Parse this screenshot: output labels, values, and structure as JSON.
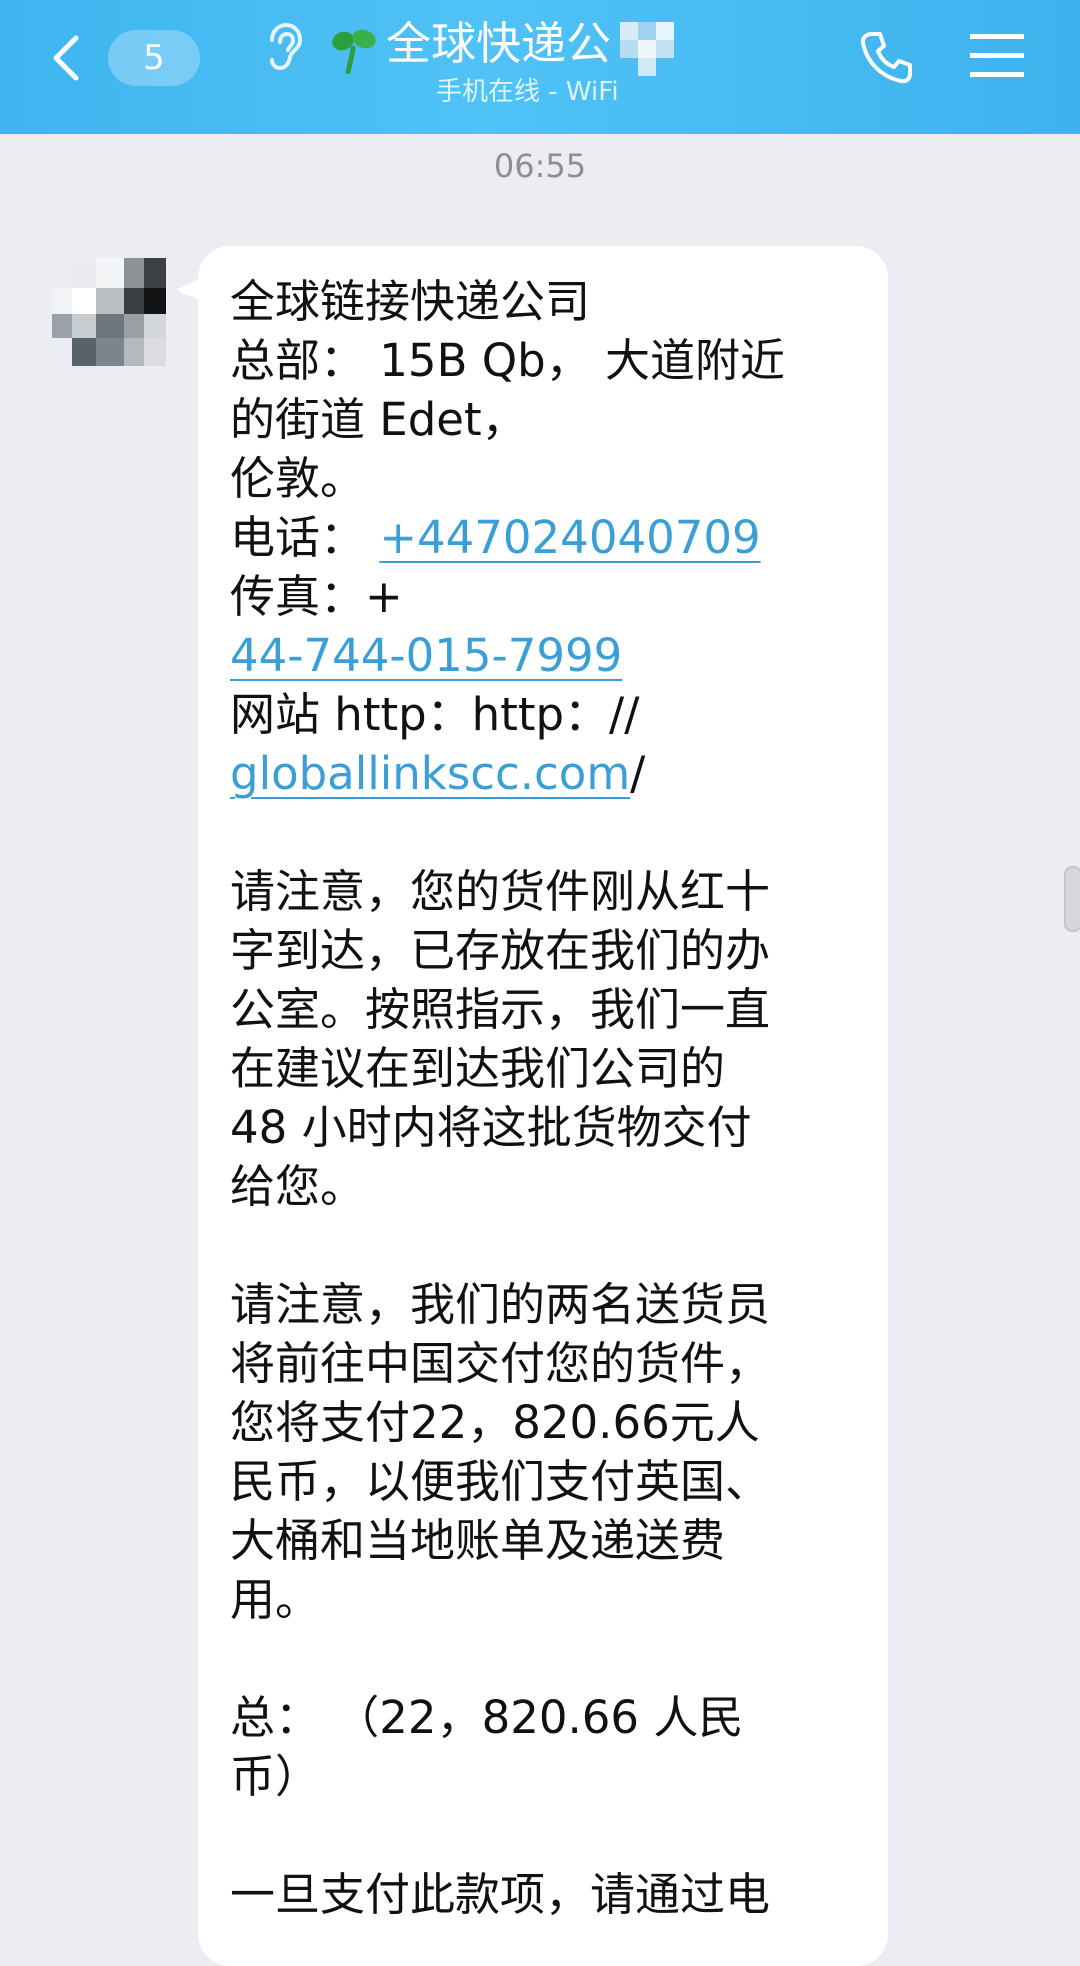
{
  "header": {
    "unread_count": "5",
    "title": "全球快递公",
    "status": "手机在线 - WiFi",
    "icons": [
      "back-chevron-icon",
      "ear-icon",
      "sprout-icon",
      "phone-icon",
      "menu-icon"
    ],
    "color": "#4ab9f2"
  },
  "chat": {
    "timestamp": "06:55",
    "message": {
      "lines": [
        "全球链接快递公司",
        "总部： 15B Qb， 大道附近",
        "的街道 Edet，",
        "伦敦。"
      ],
      "phone_label": "电话：",
      "phone_link": "+447024040709",
      "fax_label": "传真：+",
      "fax_link": "44-744-015-7999",
      "site_label": "网站 http：http：//",
      "site_link": "globallinkscc.com",
      "site_suffix": "/",
      "para1": [
        "请注意，您的货件刚从红十",
        "字到达，已存放在我们的办",
        "公室。按照指示，我们一直",
        "在建议在到达我们公司的",
        "48 小时内将这批货物交付",
        "给您。"
      ],
      "para2": [
        "请注意，我们的两名送货员",
        "将前往中国交付您的货件，",
        "您将支付22，820.66元人",
        "民币，以便我们支付英国、",
        "大桶和当地账单及递送费",
        "用。"
      ],
      "total": [
        "总：  （22，820.66 人民",
        "币）"
      ],
      "para3": [
        "一旦支付此款项，请通过电"
      ]
    }
  }
}
